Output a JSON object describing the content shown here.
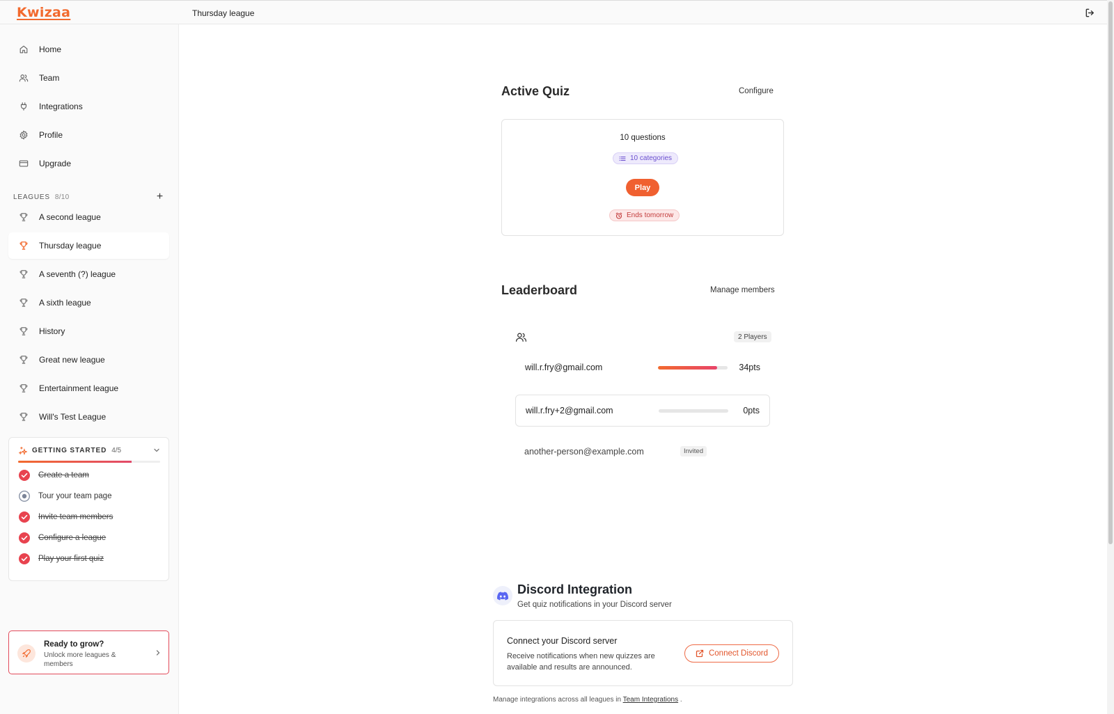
{
  "app": {
    "logo": "Kwizaa",
    "page_title": "Thursday league",
    "accent": "#f26a2e"
  },
  "nav": [
    {
      "label": "Home",
      "icon": "home-icon"
    },
    {
      "label": "Team",
      "icon": "users-icon"
    },
    {
      "label": "Integrations",
      "icon": "plug-icon"
    },
    {
      "label": "Profile",
      "icon": "gear-icon"
    },
    {
      "label": "Upgrade",
      "icon": "credit-card-icon"
    }
  ],
  "leagues": {
    "heading": "LEAGUES",
    "count": "8/10",
    "add_label": "+",
    "items": [
      {
        "label": "A second league",
        "active": false
      },
      {
        "label": "Thursday league",
        "active": true
      },
      {
        "label": "A seventh (?) league",
        "active": false
      },
      {
        "label": "A sixth league",
        "active": false
      },
      {
        "label": "History",
        "active": false
      },
      {
        "label": "Great new league",
        "active": false
      },
      {
        "label": "Entertainment league",
        "active": false
      },
      {
        "label": "Will's Test League",
        "active": false
      }
    ]
  },
  "getting_started": {
    "title": "GETTING STARTED",
    "count": "4/5",
    "progress": 0.8,
    "items": [
      {
        "label": "Create a team",
        "done": true
      },
      {
        "label": "Tour your team page",
        "done": false
      },
      {
        "label": "Invite team members",
        "done": true
      },
      {
        "label": "Configure a league",
        "done": true
      },
      {
        "label": "Play your first quiz",
        "done": true
      }
    ]
  },
  "grow": {
    "title": "Ready to grow?",
    "subtitle": "Unlock more leagues & members"
  },
  "active_quiz": {
    "title": "Active Quiz",
    "configure_label": "Configure",
    "questions": "10 questions",
    "categories": "10 categories",
    "play_label": "Play",
    "ends": "Ends tomorrow"
  },
  "leaderboard": {
    "title": "Leaderboard",
    "manage_label": "Manage members",
    "players_badge": "2 Players",
    "rows": [
      {
        "email": "will.r.fry@gmail.com",
        "points": "34pts",
        "fill": 0.85
      },
      {
        "email": "will.r.fry+2@gmail.com",
        "points": "0pts",
        "fill": 0
      }
    ],
    "invited": {
      "email": "another-person@example.com",
      "badge": "Invited"
    }
  },
  "discord": {
    "title": "Discord Integration",
    "subtitle": "Get quiz notifications in your Discord server",
    "card_title": "Connect your Discord server",
    "card_desc": "Receive notifications when new quizzes are available and results are announced.",
    "connect_label": "Connect Discord",
    "footnote_prefix": "Manage integrations across all leagues in",
    "footnote_link": "Team Integrations",
    "footnote_suffix": "."
  }
}
